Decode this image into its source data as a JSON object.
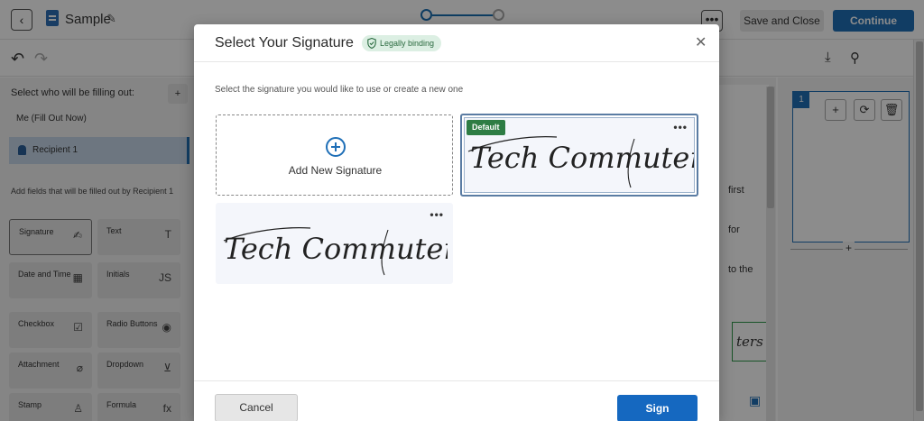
{
  "header": {
    "document_title": "Sample",
    "save_close_label": "Save and Close",
    "continue_label": "Continue"
  },
  "left_panel": {
    "title": "Select who will be filling out:",
    "me_label": "Me (Fill Out Now)",
    "recipient_label": "Recipient 1",
    "fields_note": "Add fields that will be filled out by Recipient 1",
    "fields": [
      {
        "label": "Signature",
        "icon": "pen-icon"
      },
      {
        "label": "Text",
        "icon": "text-t-icon"
      },
      {
        "label": "Date and Time",
        "icon": "calendar-icon"
      },
      {
        "label": "Initials",
        "icon": "initials-icon"
      },
      {
        "label": "Checkbox",
        "icon": "checkbox-icon"
      },
      {
        "label": "Radio Buttons",
        "icon": "radio-icon"
      },
      {
        "label": "Attachment",
        "icon": "paperclip-icon"
      },
      {
        "label": "Dropdown",
        "icon": "dropdown-icon"
      },
      {
        "label": "Stamp",
        "icon": "stamp-icon"
      },
      {
        "label": "Formula",
        "icon": "fx-icon"
      }
    ]
  },
  "document": {
    "text_fragments": [
      "first",
      "for",
      "to the"
    ],
    "signature_field_text": "ters"
  },
  "thumbnails": {
    "page_number": "1"
  },
  "modal": {
    "title": "Select Your Signature",
    "badge": "Legally binding",
    "subtitle": "Select the signature you would like to use or create a new one",
    "add_new_label": "Add New Signature",
    "default_badge": "Default",
    "signature_text": "Tech Commuters",
    "cancel_label": "Cancel",
    "sign_label": "Sign"
  },
  "colors": {
    "primary": "#1f6fb7",
    "badge_green_bg": "#dcefe3",
    "default_green": "#2e7d44"
  }
}
